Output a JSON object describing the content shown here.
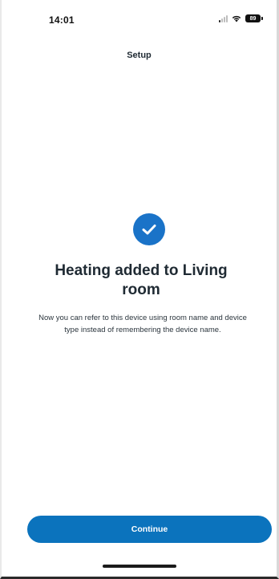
{
  "status_bar": {
    "time": "14:01",
    "battery_level": "89"
  },
  "header": {
    "title": "Setup"
  },
  "success": {
    "icon": "check-circle-icon",
    "title": "Heating added to Living room",
    "message": "Now you can refer to this device using room name and device type instead of remembering the device name."
  },
  "actions": {
    "continue_label": "Continue"
  },
  "colors": {
    "accent": "#1a73c8",
    "button": "#0b73bd",
    "text": "#1f2a33"
  }
}
